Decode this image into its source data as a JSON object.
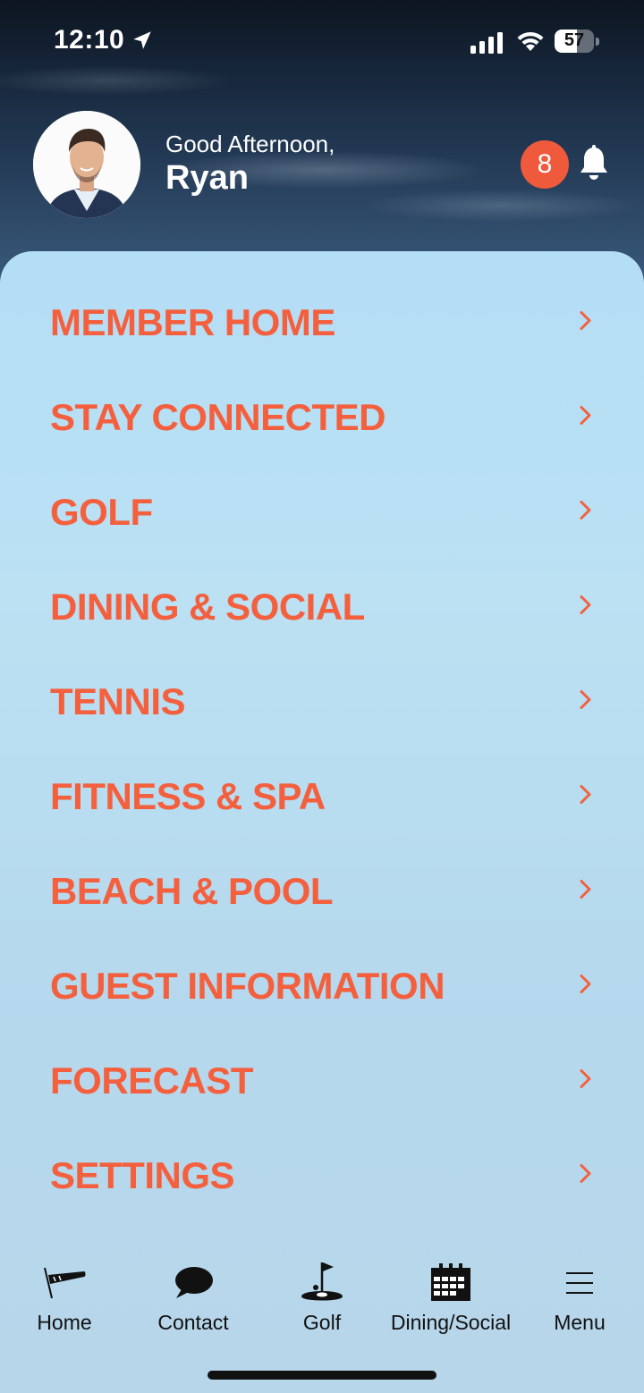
{
  "status_bar": {
    "time": "12:10",
    "battery": "57",
    "battery_level": 0.57
  },
  "header": {
    "greeting": "Good Afternoon,",
    "name": "Ryan",
    "notification_count": "8"
  },
  "menu": {
    "items": [
      {
        "label": "MEMBER HOME"
      },
      {
        "label": "STAY CONNECTED"
      },
      {
        "label": "GOLF"
      },
      {
        "label": "DINING & SOCIAL"
      },
      {
        "label": "TENNIS"
      },
      {
        "label": "FITNESS & SPA"
      },
      {
        "label": "BEACH & POOL"
      },
      {
        "label": "GUEST INFORMATION"
      },
      {
        "label": "FORECAST"
      },
      {
        "label": "SETTINGS"
      }
    ]
  },
  "tab_bar": {
    "tabs": [
      {
        "label": "Home",
        "icon": "windsock-icon"
      },
      {
        "label": "Contact",
        "icon": "chat-bubble-icon"
      },
      {
        "label": "Golf",
        "icon": "golf-flag-icon"
      },
      {
        "label": "Dining/Social",
        "icon": "calendar-icon"
      },
      {
        "label": "Menu",
        "icon": "hamburger-menu-icon"
      }
    ]
  },
  "colors": {
    "accent": "#f4603e",
    "badge": "#f05a3c",
    "panel": "#b8dcf2"
  }
}
